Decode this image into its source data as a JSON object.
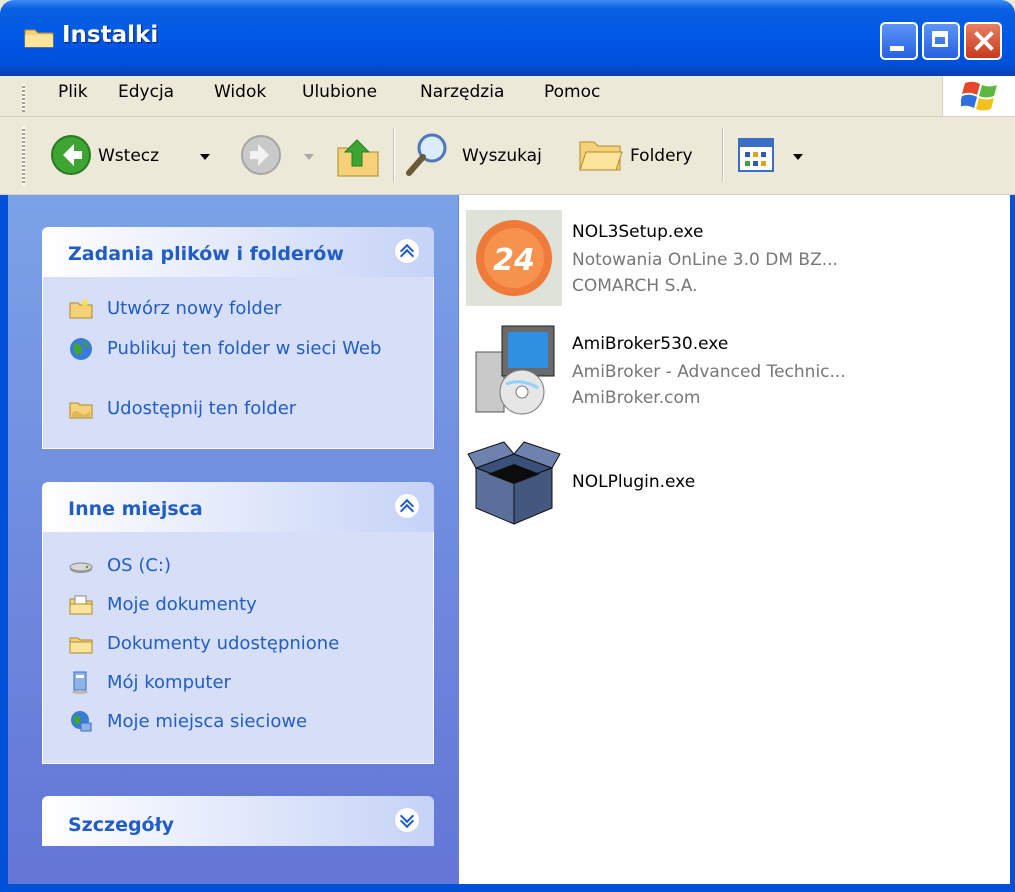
{
  "window": {
    "title": "Instalki"
  },
  "menu": {
    "items": [
      "Plik",
      "Edycja",
      "Widok",
      "Ulubione",
      "Narzędzia",
      "Pomoc"
    ]
  },
  "toolbar": {
    "back_label": "Wstecz",
    "search_label": "Wyszukaj",
    "folders_label": "Foldery"
  },
  "panels": {
    "tasks": {
      "title": "Zadania plików i folderów",
      "items": [
        "Utwórz nowy folder",
        "Publikuj ten folder w sieci Web",
        "Udostępnij ten folder"
      ]
    },
    "places": {
      "title": "Inne miejsca",
      "items": [
        "OS (C:)",
        "Moje dokumenty",
        "Dokumenty udostępnione",
        "Mój komputer",
        "Moje miejsca sieciowe"
      ]
    },
    "details": {
      "title": "Szczegóły"
    }
  },
  "files": [
    {
      "name": "NOL3Setup.exe",
      "description": "Notowania OnLine 3.0 DM BZ...",
      "company": "COMARCH S.A."
    },
    {
      "name": "AmiBroker530.exe",
      "description": "AmiBroker - Advanced Technic...",
      "company": "AmiBroker.com"
    },
    {
      "name": "NOLPlugin.exe"
    }
  ],
  "colors": {
    "titlebar": "#0058e6",
    "link": "#215dc6",
    "pane_gradient_top": "#7ba2e7",
    "pane_gradient_bottom": "#6375d6"
  }
}
